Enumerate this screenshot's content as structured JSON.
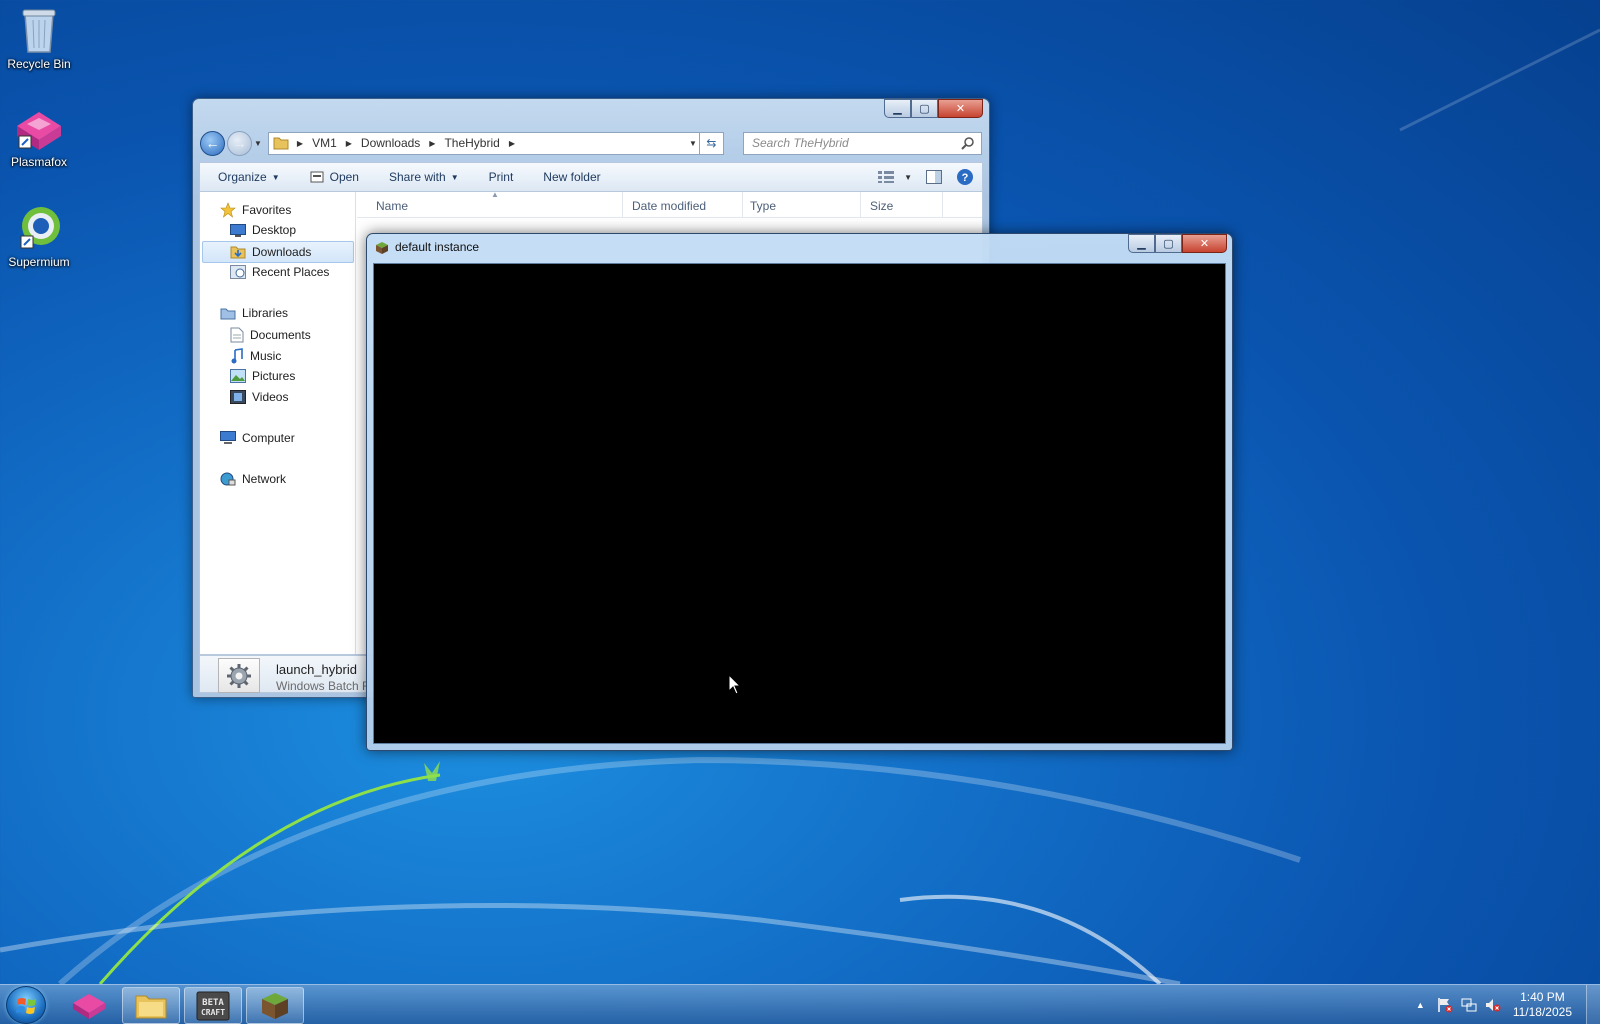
{
  "desktop": {
    "icons": [
      {
        "label": "Recycle Bin",
        "icon": "recycle-bin-icon"
      },
      {
        "label": "Plasmafox",
        "icon": "plasmafox-icon"
      },
      {
        "label": "Supermium",
        "icon": "supermium-icon"
      }
    ]
  },
  "explorer": {
    "breadcrumb": [
      "VM1",
      "Downloads",
      "TheHybrid"
    ],
    "search_placeholder": "Search TheHybrid",
    "toolbar": {
      "organize": "Organize",
      "open": "Open",
      "share_with": "Share with",
      "print": "Print",
      "new_folder": "New folder"
    },
    "nav": {
      "favorites": "Favorites",
      "desktop": "Desktop",
      "downloads": "Downloads",
      "recent_places": "Recent Places",
      "libraries": "Libraries",
      "documents": "Documents",
      "music": "Music",
      "pictures": "Pictures",
      "videos": "Videos",
      "computer": "Computer",
      "network": "Network"
    },
    "selected_nav": "Downloads",
    "columns": {
      "name": "Name",
      "date_modified": "Date modified",
      "type": "Type",
      "size": "Size"
    },
    "details": {
      "file_name": "launch_hybrid",
      "file_type": "Windows Batch F"
    }
  },
  "game_window": {
    "title": "default instance"
  },
  "taskbar": {
    "pinned": [
      "plasmafox-icon",
      "file-explorer-icon",
      "betacraft-icon",
      "minecraft-grass-icon"
    ],
    "clock_time": "1:40 PM",
    "clock_date": "11/18/2025"
  },
  "colors": {
    "wallpaper": "#1370c8",
    "game_screen": "#000000",
    "close_button": "#c84330"
  }
}
